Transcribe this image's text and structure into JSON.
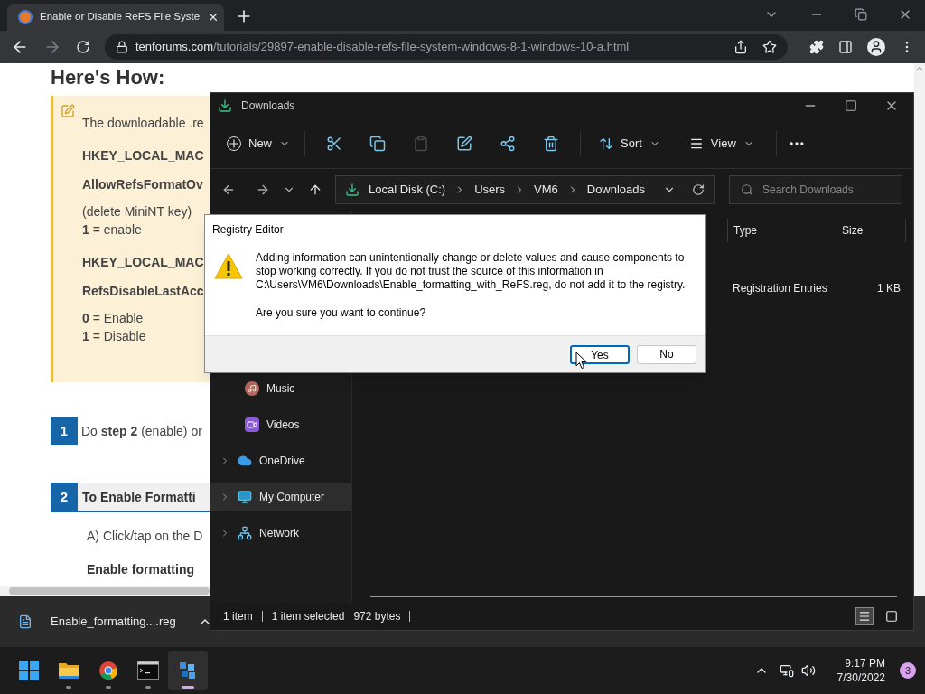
{
  "browser": {
    "tab": {
      "title": "Enable or Disable ReFS File Syste"
    },
    "url": {
      "domain": "tenforums.com",
      "path": "/tutorials/29897-enable-disable-refs-file-system-windows-8-1-windows-10-a.html"
    }
  },
  "article": {
    "heading": "Here's How:",
    "note": [
      {
        "kind": "text",
        "text": "The downloadable .re"
      },
      {
        "kind": "key",
        "text": "HKEY_LOCAL_MAC"
      },
      {
        "kind": "key",
        "text": "AllowRefsFormatOv"
      },
      {
        "kind": "text",
        "text": "(delete MiniNT key)"
      },
      {
        "kind": "tight",
        "text": "**1** = enable"
      },
      {
        "kind": "key",
        "text": "HKEY_LOCAL_MAC"
      },
      {
        "kind": "key",
        "text": "RefsDisableLastAcc"
      },
      {
        "kind": "text",
        "text": "**0** = Enable"
      },
      {
        "kind": "tight",
        "text": "**1** = Disable"
      }
    ],
    "step1": {
      "number": "1",
      "text": "Do **step 2** (enable) or"
    },
    "step2": {
      "number": "2",
      "title": "To Enable Formatti"
    },
    "paragraph": "A) Click/tap on the D",
    "subheading": "Enable formatting"
  },
  "download_bar": {
    "file": "Enable_formatting....reg"
  },
  "explorer": {
    "title": "Downloads",
    "toolbar": {
      "new": "New",
      "actions": [
        {
          "disabled": false
        },
        {
          "disabled": false
        },
        {
          "disabled": true
        },
        {
          "disabled": false
        },
        {
          "disabled": false
        },
        {
          "disabled": false
        }
      ],
      "sort": "Sort",
      "view": "View"
    },
    "path": [
      "Local Disk (C:)",
      "Users",
      "VM6",
      "Downloads"
    ],
    "search": {
      "placeholder": "Search Downloads"
    },
    "columns": [
      "Type",
      "Size"
    ],
    "rows": [
      {
        "type": "Registration Entries",
        "size": "1 KB"
      }
    ],
    "sidebar": [
      {
        "kind": "music",
        "label": "Music",
        "expandable": false,
        "selected": false
      },
      {
        "kind": "videos",
        "label": "Videos",
        "expandable": false,
        "selected": false
      },
      {
        "kind": "cloud",
        "label": "OneDrive",
        "expandable": true,
        "selected": false
      },
      {
        "kind": "computer",
        "label": "My Computer",
        "expandable": true,
        "selected": true
      },
      {
        "kind": "network",
        "label": "Network",
        "expandable": true,
        "selected": false
      }
    ],
    "status": {
      "count": "1 item",
      "selected": "1 item selected",
      "size": "972 bytes"
    },
    "views": [
      {
        "kind": "details",
        "selected": true
      },
      {
        "kind": "tiles",
        "selected": false
      }
    ]
  },
  "dialog": {
    "title": "Registry Editor",
    "message": "Adding information can unintentionally change or delete values and cause components to stop working correctly. If you do not trust the source of this information in C:\\Users\\VM6\\Downloads\\Enable_formatting_with_ReFS.reg, do not add it to the registry.",
    "question": "Are you sure you want to continue?",
    "buttons": [
      {
        "label": "Yes",
        "focused": true
      },
      {
        "label": "No",
        "focused": false
      }
    ]
  },
  "taskbar": {
    "apps": [
      {
        "kind": "start",
        "active": false
      },
      {
        "kind": "folder",
        "active": false
      },
      {
        "kind": "chrome",
        "active": false
      },
      {
        "kind": "terminal",
        "active": false
      },
      {
        "kind": "regedit",
        "active": true
      }
    ],
    "time": "9:17 PM",
    "date": "7/30/2022",
    "notifications": "3"
  }
}
